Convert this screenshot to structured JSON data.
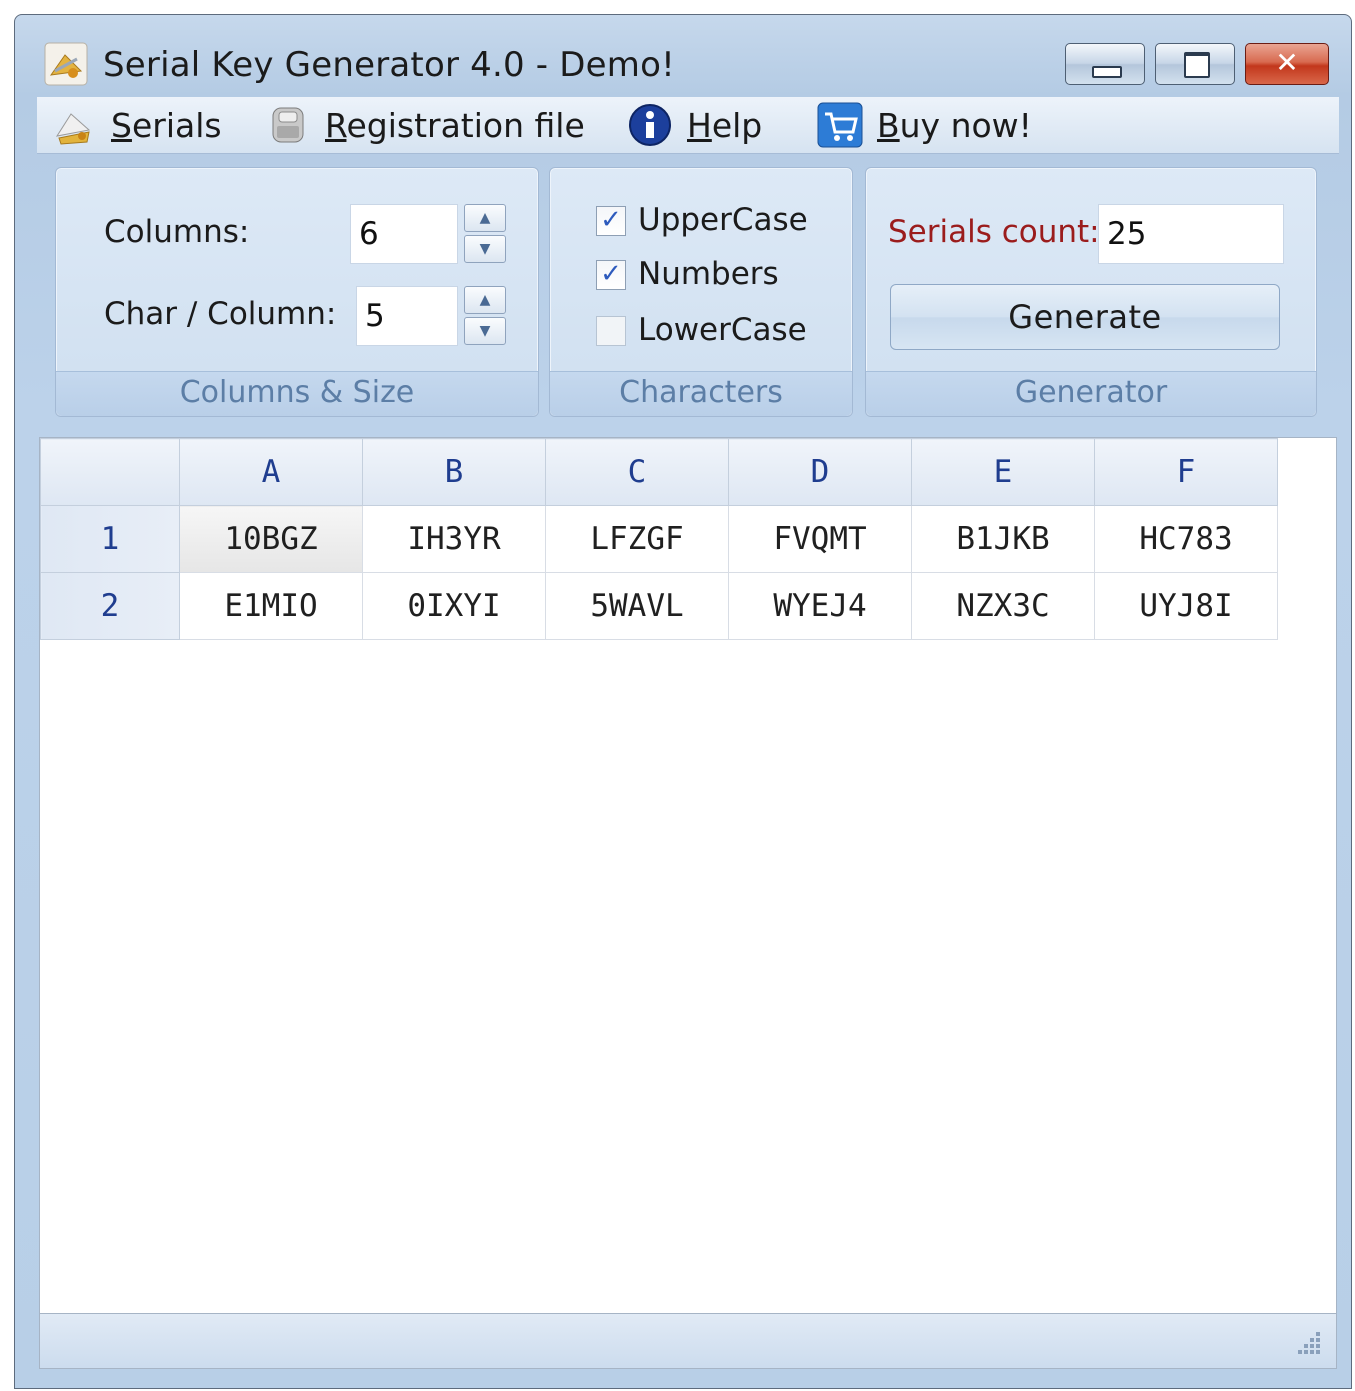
{
  "window": {
    "title": "Serial Key Generator 4.0 - Demo!",
    "controls": {
      "minimize": "minimize",
      "maximize": "maximize",
      "close": "✕"
    }
  },
  "menu": {
    "serials": {
      "accel": "S",
      "rest": "erials",
      "icon": "serials-icon"
    },
    "registration": {
      "accel": "R",
      "rest": "egistration file",
      "icon": "lock-icon"
    },
    "help": {
      "accel": "H",
      "rest": "elp",
      "icon": "info-icon"
    },
    "buy": {
      "accel": "B",
      "rest": "uy now!",
      "icon": "cart-icon"
    }
  },
  "columns_size": {
    "caption": "Columns & Size",
    "columns_label": "Columns:",
    "columns_value": "6",
    "char_label": "Char / Column:",
    "char_value": "5"
  },
  "characters": {
    "caption": "Characters",
    "options": [
      {
        "label": "UpperCase",
        "checked": true
      },
      {
        "label": "Numbers",
        "checked": true
      },
      {
        "label": "LowerCase",
        "checked": false
      }
    ]
  },
  "generator": {
    "caption": "Generator",
    "count_label": "Serials count:",
    "count_value": "25",
    "button": "Generate",
    "label_color": "#9b1c1c"
  },
  "grid": {
    "columns": [
      "A",
      "B",
      "C",
      "D",
      "E",
      "F"
    ],
    "rows": [
      {
        "index": "1",
        "cells": [
          "10BGZ",
          "IH3YR",
          "LFZGF",
          "FVQMT",
          "B1JKB",
          "HC783"
        ]
      },
      {
        "index": "2",
        "cells": [
          "E1MIO",
          "0IXYI",
          "5WAVL",
          "WYEJ4",
          "NZX3C",
          "UYJ8I"
        ]
      }
    ],
    "selected_cell": "A1"
  }
}
